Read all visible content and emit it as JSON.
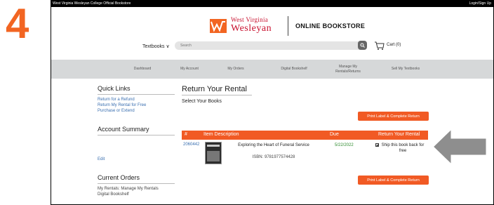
{
  "step_number": "4",
  "topbar": {
    "left_text": "West Virginia Wesleyan College Official Bookstore",
    "login_text": "Login/Sign Up"
  },
  "logo": {
    "line1": "West Virginia",
    "line2": "Wesleyan",
    "store": "ONLINE BOOKSTORE"
  },
  "header": {
    "textbooks_label": "Textbooks ∨",
    "search_placeholder": "Search",
    "cart_label": "Cart (0)"
  },
  "menu": {
    "dashboard": "Dashboard",
    "my_account": "My Account",
    "my_orders": "My Orders",
    "digital_bookshelf": "Digital Bookshelf",
    "manage_line1": "Manage My",
    "manage_line2": "Rentals/Returns",
    "sell": "Sell My Textbooks"
  },
  "sidebar": {
    "quick_links_title": "Quick Links",
    "link_refund": "Return for a Refund",
    "link_rental_free": "Return My Rental for Free",
    "link_purchase": "Purchase or Extend",
    "account_summary_title": "Account Summary",
    "edit_link": "Edit",
    "current_orders_title": "Current Orders",
    "my_rentals_prefix": "My Rentals: ",
    "manage_rentals_link": "Manage My Rentals",
    "digital_bookshelf_link": "Digital Bookshelf"
  },
  "main": {
    "page_title": "Return Your Rental",
    "select_books": "Select Your Books",
    "print_button": "Print Label & Complete Return",
    "columns": {
      "num": "#",
      "item": "Item Description",
      "due": "Due",
      "return": "Return Your Rental"
    },
    "rows": [
      {
        "num": "2060442",
        "title": "Exploring the Heart of Funeral Service",
        "isbn": "ISBN: 9781977574428",
        "due": "5/22/2022",
        "ship_label": "Ship this book back for free",
        "checked": true
      }
    ]
  },
  "colors": {
    "accent": "#f15a24",
    "step": "#f26522",
    "brand_red": "#c8102e",
    "link": "#3a6fb0",
    "due_green": "#2e8b2e",
    "menubar": "#d6d8d9"
  },
  "icons": {
    "search_button": "search-icon",
    "cart": "cart-icon",
    "pointer": "arrow-left-icon",
    "logo": "wesleyan-logo-mark"
  }
}
